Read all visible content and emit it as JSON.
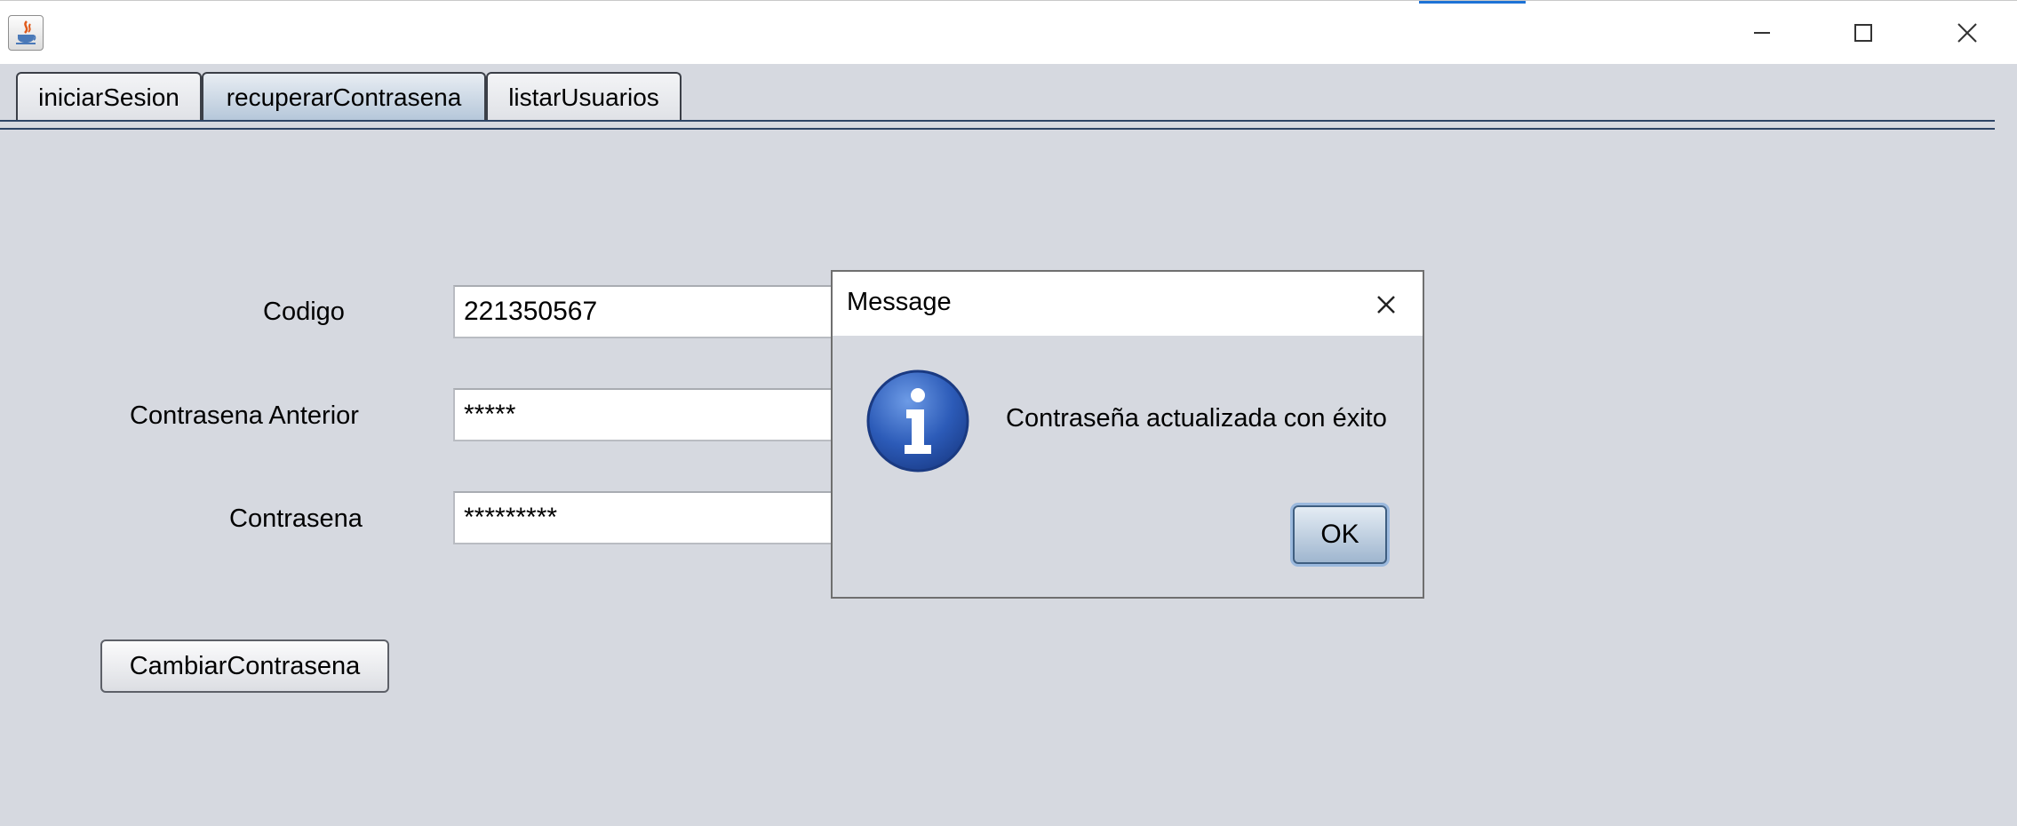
{
  "window": {
    "icon": "java-coffee-icon",
    "controls": [
      "minimize-icon",
      "maximize-icon",
      "close-icon"
    ]
  },
  "tabs": [
    {
      "label": "iniciarSesion",
      "selected": false
    },
    {
      "label": "recuperarContrasena",
      "selected": true
    },
    {
      "label": "listarUsuarios",
      "selected": false
    }
  ],
  "form": {
    "codigo_label": "Codigo",
    "codigo_value": "221350567",
    "old_password_label": "Contrasena Anterior",
    "old_password_value": "*****",
    "password_label": "Contrasena",
    "password_value": "*********",
    "submit_label": "CambiarContrasena"
  },
  "dialog": {
    "title": "Message",
    "icon": "info-icon",
    "message": "Contraseña actualizada con éxito",
    "ok_label": "OK"
  },
  "colors": {
    "background": "#d6d9e0",
    "tab_selected": "#b4c6d9",
    "tab_separator": "#2e4566",
    "accent": "#1e73d6",
    "info_icon_blue": "#2c5bb8"
  }
}
